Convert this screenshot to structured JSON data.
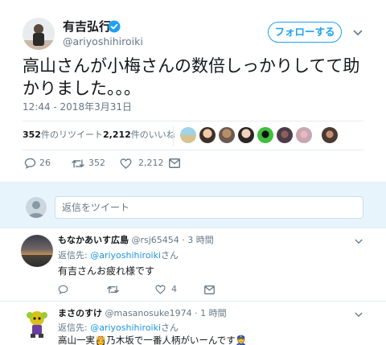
{
  "tweet": {
    "display_name": "有吉弘行",
    "handle": "@ariyoshihiroiki",
    "follow_label": "フォローする",
    "text_line1": "高山さんが小梅さんの数倍しっかりしてて助",
    "text_line2": "かりました。。。",
    "timestamp": "12:44 - 2018年3月31日",
    "retweets_count": "352",
    "retweets_suffix": "件のリツイート",
    "likes_count": "2,212",
    "likes_suffix": "件のいいね",
    "actions": {
      "replies": "26",
      "retweets": "352",
      "likes": "2,212"
    }
  },
  "reply_box": {
    "placeholder": "返信をツイート"
  },
  "replies": [
    {
      "name": "もなかあいす広島",
      "handle": "@rsj65454",
      "time": "· 3 時間",
      "reply_prefix": "返信先: ",
      "reply_to": "@ariyoshihiroiki",
      "reply_suffix": "さん",
      "text": "有吉さんお疲れ様です",
      "likes": "4"
    },
    {
      "name": "まさのすけ",
      "handle": "@masanosuke1974",
      "time": "· 1 時間",
      "reply_prefix": "返信先: ",
      "reply_to": "@ariyoshihiroiki",
      "reply_suffix": "さん",
      "text": "高山一実👸乃木坂で一番人柄がいーんです👮"
    }
  ],
  "colors": {
    "accent": "#1da1f2",
    "link": "#1b95e0",
    "muted": "#657786",
    "divider": "#e6ecf0"
  }
}
